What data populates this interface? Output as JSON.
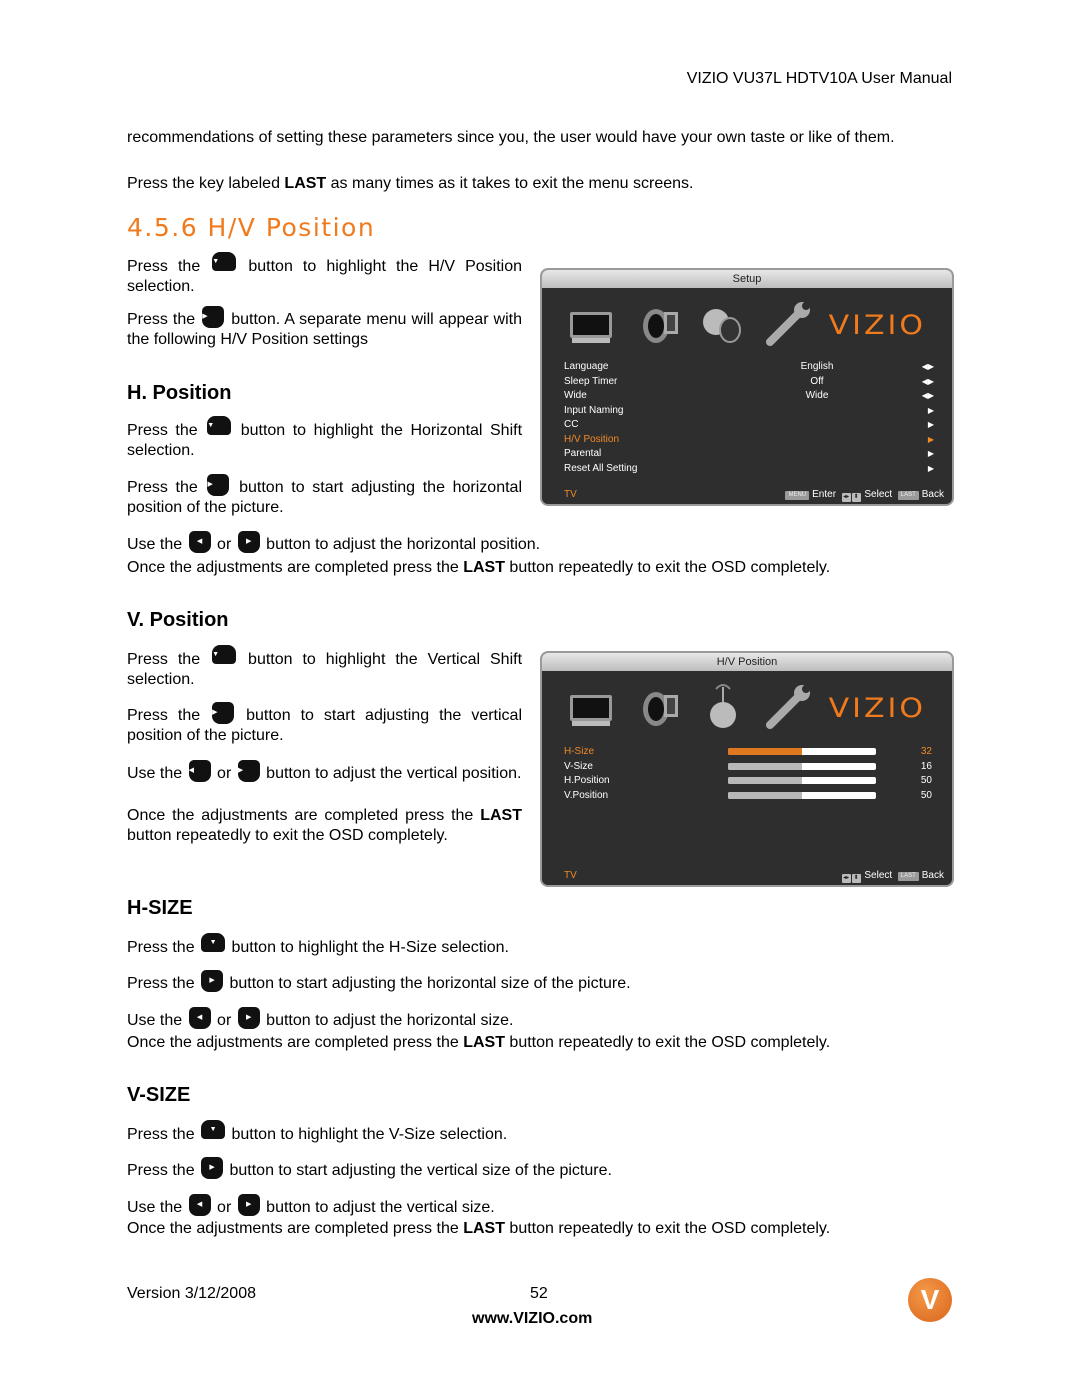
{
  "header": {
    "title": "VIZIO VU37L HDTV10A User Manual"
  },
  "intro": {
    "para1": "recommendations of setting these parameters since you, the user would have your own taste or like of them.",
    "para2_pre": "Press the key labeled ",
    "para2_bold": "LAST",
    "para2_post": " as many times as it takes to exit the menu screens."
  },
  "section": {
    "title": "4.5.6 H/V Position",
    "p1_pre": "Press the ",
    "p1_post": " button to highlight the H/V Position selection.",
    "p2_pre": " Press the ",
    "p2_post": " button. A separate menu will appear with the following H/V Position settings"
  },
  "h_position": {
    "heading": "H. Position",
    "p1_pre": "Press the ",
    "p1_post": " button to highlight the Horizontal Shift selection.",
    "p2_pre": "Press the ",
    "p2_post": " button to start adjusting the horizontal position of the picture.",
    "p3_pre": "Use the ",
    "p3_mid": " or ",
    "p3_post": " button to adjust the horizontal position.",
    "p4_pre": "Once the adjustments are completed press the ",
    "p4_bold": "LAST",
    "p4_post": " button repeatedly to exit the OSD completely."
  },
  "v_position": {
    "heading": "V. Position",
    "p1_pre": "Press the ",
    "p1_post": " button to highlight the Vertical Shift selection.",
    "p2_pre": "Press the ",
    "p2_post": " button to start adjusting the vertical position of the picture.",
    "p3_pre": "Use the ",
    "p3_mid": " or ",
    "p3_post": " button to adjust the vertical position.",
    "p4_pre": "Once the adjustments are completed press the ",
    "p4_bold": "LAST",
    "p4_post": " button repeatedly to exit the OSD completely."
  },
  "h_size": {
    "heading": "H-SIZE",
    "p1_pre": "Press the ",
    "p1_post": " button to highlight the H-Size selection.",
    "p2_pre": "Press the ",
    "p2_post": " button to start adjusting the horizontal size of the picture.",
    "p3_pre": "Use the ",
    "p3_mid": " or ",
    "p3_post": " button to adjust the horizontal size.",
    "p4_pre": "Once the adjustments are completed press the ",
    "p4_bold": "LAST",
    "p4_post": " button repeatedly to exit the OSD completely."
  },
  "v_size": {
    "heading": "V-SIZE",
    "p1_pre": "Press the ",
    "p1_post": " button to highlight the V-Size selection.",
    "p2_pre": "Press the ",
    "p2_post": " button to start adjusting the vertical size of the picture.",
    "p3_pre": "Use the ",
    "p3_mid": " or ",
    "p3_post": " button to adjust the vertical size.",
    "p4_pre": "Once the adjustments are completed press the ",
    "p4_bold": "LAST",
    "p4_post": " button repeatedly to exit the OSD completely."
  },
  "icons": {
    "down": "▼",
    "right": "▶",
    "left": "◀"
  },
  "osd_setup": {
    "title": "Setup",
    "brand": "VIZIO",
    "icons": [
      "tv-icon",
      "audio-icon",
      "globe-dish-icon",
      "wrench-icon"
    ],
    "rows": [
      {
        "label": "Language",
        "value": "English",
        "arrow": "◀▶",
        "selected": false
      },
      {
        "label": "Sleep Timer",
        "value": "Off",
        "arrow": "◀▶",
        "selected": false
      },
      {
        "label": "Wide",
        "value": "Wide",
        "arrow": "◀▶",
        "selected": false
      },
      {
        "label": "Input Naming",
        "value": "",
        "arrow": "▶",
        "selected": false
      },
      {
        "label": "CC",
        "value": "",
        "arrow": "▶",
        "selected": false
      },
      {
        "label": "H/V Position",
        "value": "",
        "arrow": "▶",
        "selected": true
      },
      {
        "label": "Parental",
        "value": "",
        "arrow": "▶",
        "selected": false
      },
      {
        "label": "Reset All Setting",
        "value": "",
        "arrow": "▶",
        "selected": false
      }
    ],
    "footer": {
      "source": "TV",
      "menu_key": "MENU",
      "enter": "Enter",
      "select": "Select",
      "last_key": "LAST",
      "back": "Back"
    }
  },
  "osd_hv": {
    "title": "H/V Position",
    "brand": "VIZIO",
    "rows": [
      {
        "label": "H-Size",
        "value": "32",
        "fill": 0.5,
        "selected": true
      },
      {
        "label": "V-Size",
        "value": "16",
        "fill": 0.5,
        "selected": false
      },
      {
        "label": "H.Position",
        "value": "50",
        "fill": 0.5,
        "selected": false
      },
      {
        "label": "V.Position",
        "value": "50",
        "fill": 0.5,
        "selected": false
      }
    ],
    "footer": {
      "source": "TV",
      "select": "Select",
      "last_key": "LAST",
      "back": "Back"
    }
  },
  "footer": {
    "version": "Version 3/12/2008",
    "page": "52",
    "url": "www.VIZIO.com",
    "logo_letter": "V"
  },
  "colors": {
    "accent": "#f07a1c",
    "osd_bg": "#2e2e2e"
  }
}
